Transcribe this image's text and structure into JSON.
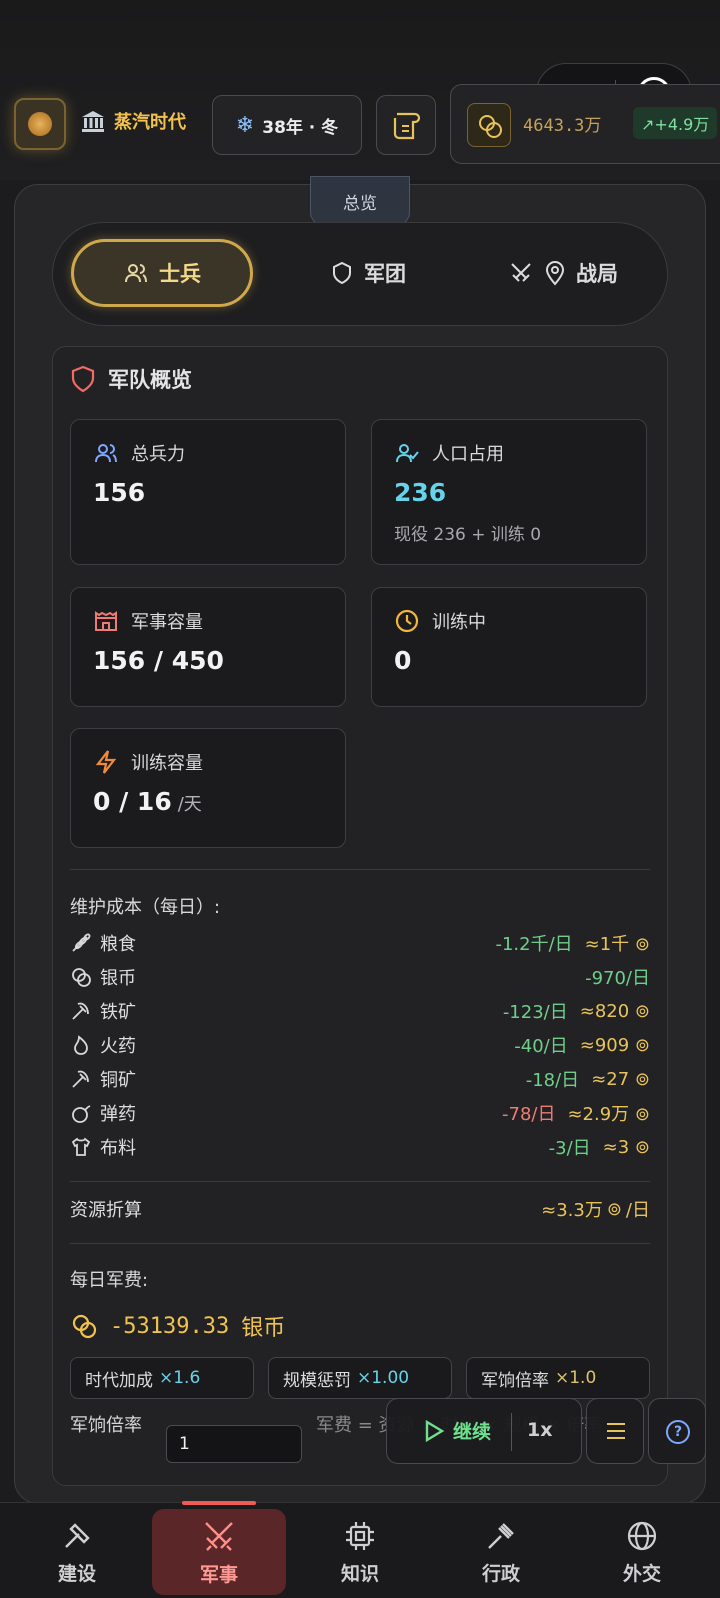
{
  "header": {
    "era_label": "蒸汽时代",
    "date_label": "38年 · 冬",
    "silver_amount": "4643.3万",
    "silver_rate": "+4.9万"
  },
  "panel": {
    "tab_label": "总览",
    "tabs": [
      {
        "label": "士兵",
        "active": true
      },
      {
        "label": "军团",
        "active": false
      },
      {
        "label": "战局",
        "active": false
      }
    ]
  },
  "overview": {
    "title": "军队概览",
    "stats": {
      "total_troops": {
        "label": "总兵力",
        "value": "156"
      },
      "population": {
        "label": "人口占用",
        "value": "236",
        "detail": "现役 236 + 训练 0"
      },
      "capacity": {
        "label": "军事容量",
        "value": "156 / 450"
      },
      "training": {
        "label": "训练中",
        "value": "0"
      },
      "train_capacity": {
        "label": "训练容量",
        "value": "0 / 16",
        "unit": "/天"
      }
    },
    "upkeep_title": "维护成本（每日）:",
    "upkeep": [
      {
        "name": "粮食",
        "rate": "-1.2千/日",
        "approx": "≈1千",
        "icon": "wheat-icon",
        "rate_color": "green"
      },
      {
        "name": "银币",
        "rate": "-970/日",
        "approx": "",
        "icon": "silver-coin-icon",
        "rate_color": "green"
      },
      {
        "name": "铁矿",
        "rate": "-123/日",
        "approx": "≈820",
        "icon": "pickaxe-icon",
        "rate_color": "green"
      },
      {
        "name": "火药",
        "rate": "-40/日",
        "approx": "≈909",
        "icon": "flame-icon",
        "rate_color": "green"
      },
      {
        "name": "铜矿",
        "rate": "-18/日",
        "approx": "≈27",
        "icon": "pickaxe-icon",
        "rate_color": "green"
      },
      {
        "name": "弹药",
        "rate": "-78/日",
        "approx": "≈2.9万",
        "icon": "bomb-icon",
        "rate_color": "red"
      },
      {
        "name": "布料",
        "rate": "-3/日",
        "approx": "≈3",
        "icon": "shirt-icon",
        "rate_color": "green"
      }
    ],
    "conversion_label": "资源折算",
    "conversion_value": "≈3.3万",
    "conversion_unit": "/日",
    "daily_fee_label": "每日军费:",
    "daily_fee_value": "-53139.33",
    "daily_fee_unit": "银币",
    "modifiers": [
      {
        "label": "时代加成",
        "value": "×1.6"
      },
      {
        "label": "规模惩罚",
        "value": "×1.00"
      },
      {
        "label": "军饷倍率",
        "value": "×1.0"
      }
    ],
    "pay_rate_label": "军饷倍率",
    "pay_rate_value": "1",
    "formula_text": "军费 = 资源 × 时代 × 规模 × 倍率"
  },
  "controls": {
    "continue_label": "继续",
    "speed_label": "1x"
  },
  "bottom_nav": [
    {
      "label": "建设",
      "icon": "hammer-icon",
      "active": false
    },
    {
      "label": "军事",
      "icon": "crossed-swords-icon",
      "active": true
    },
    {
      "label": "知识",
      "icon": "chip-icon",
      "active": false
    },
    {
      "label": "行政",
      "icon": "gavel-icon",
      "active": false
    },
    {
      "label": "外交",
      "icon": "globe-icon",
      "active": false
    }
  ],
  "colors": {
    "accent_gold": "#cfa84b",
    "positive": "#6fcf8a",
    "negative": "#ef7b74",
    "active_nav": "#5a2628"
  }
}
